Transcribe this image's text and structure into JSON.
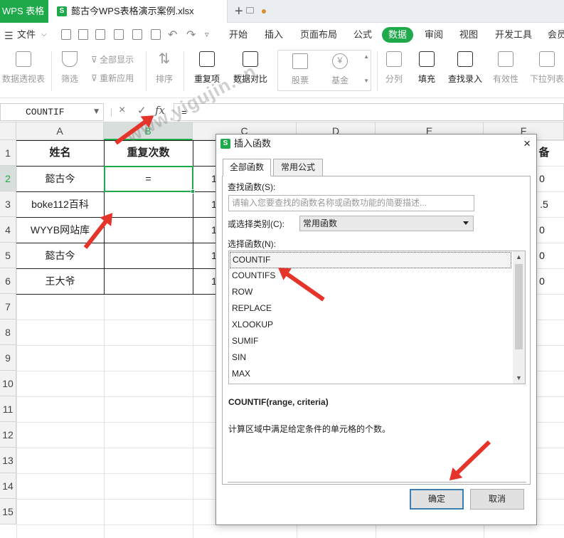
{
  "titlebar": {
    "app_tab": "WPS 表格",
    "file_icon": "S",
    "file_name": "懿古今WPS表格演示案例.xlsx",
    "new_tab": "+"
  },
  "menubar": {
    "file_menu": "文件",
    "items": [
      "开始",
      "插入",
      "页面布局",
      "公式",
      "数据",
      "审阅",
      "视图",
      "开发工具",
      "会员"
    ],
    "active": "数据"
  },
  "ribbon": {
    "pivot": "数据透视表",
    "filter": "筛选",
    "show_all": "全部显示",
    "reapply": "重新应用",
    "sort": "排序",
    "duplicates": "重复项",
    "compare": "数据对比",
    "stocks": "股票",
    "funds": "基金",
    "split": "分列",
    "fill": "填充",
    "find_entry": "查找录入",
    "validity": "有效性",
    "dropdown_list": "下拉列表"
  },
  "formulabar": {
    "name_box": "COUNTIF",
    "fx": "fx",
    "cancel": "×",
    "confirm": "✓",
    "formula": "="
  },
  "grid": {
    "columns": [
      "A",
      "B",
      "C",
      "D",
      "E",
      "F"
    ],
    "selected_column": "B",
    "rows": [
      "1",
      "2",
      "3",
      "4",
      "5",
      "6",
      "7",
      "8",
      "9",
      "10",
      "11",
      "12",
      "13",
      "14",
      "15"
    ],
    "selected_row": "2",
    "col_a": [
      "姓名",
      "懿古今",
      "boke112百科",
      "WYYB网站库",
      "懿古今",
      "王大爷"
    ],
    "col_b": [
      "重复次数",
      "=",
      "",
      "",
      "",
      ""
    ],
    "col_c_partial": [
      "",
      "1",
      "1",
      "1",
      "1",
      "1"
    ],
    "col_f_partial": [
      "备",
      "0",
      ".5",
      "0",
      "0",
      "0"
    ]
  },
  "dialog": {
    "title_icon": "S",
    "title": "插入函数",
    "close": "×",
    "tabs": [
      "全部函数",
      "常用公式"
    ],
    "active_tab": "全部函数",
    "search_label": "查找函数(S):",
    "search_placeholder": "请输入您要查找的函数名称或函数功能的简要描述...",
    "category_label": "或选择类别(C):",
    "category_value": "常用函数",
    "list_label": "选择函数(N):",
    "functions": [
      "COUNTIF",
      "COUNTIFS",
      "ROW",
      "REPLACE",
      "XLOOKUP",
      "SUMIF",
      "SIN",
      "MAX"
    ],
    "selected_function": "COUNTIF",
    "signature": "COUNTIF(range, criteria)",
    "description": "计算区域中满足给定条件的单元格的个数。",
    "ok": "确定",
    "cancel": "取消"
  },
  "watermark": "www.yigujin.cn",
  "colors": {
    "accent": "#1ea94a",
    "arrow": "#e5352b"
  }
}
